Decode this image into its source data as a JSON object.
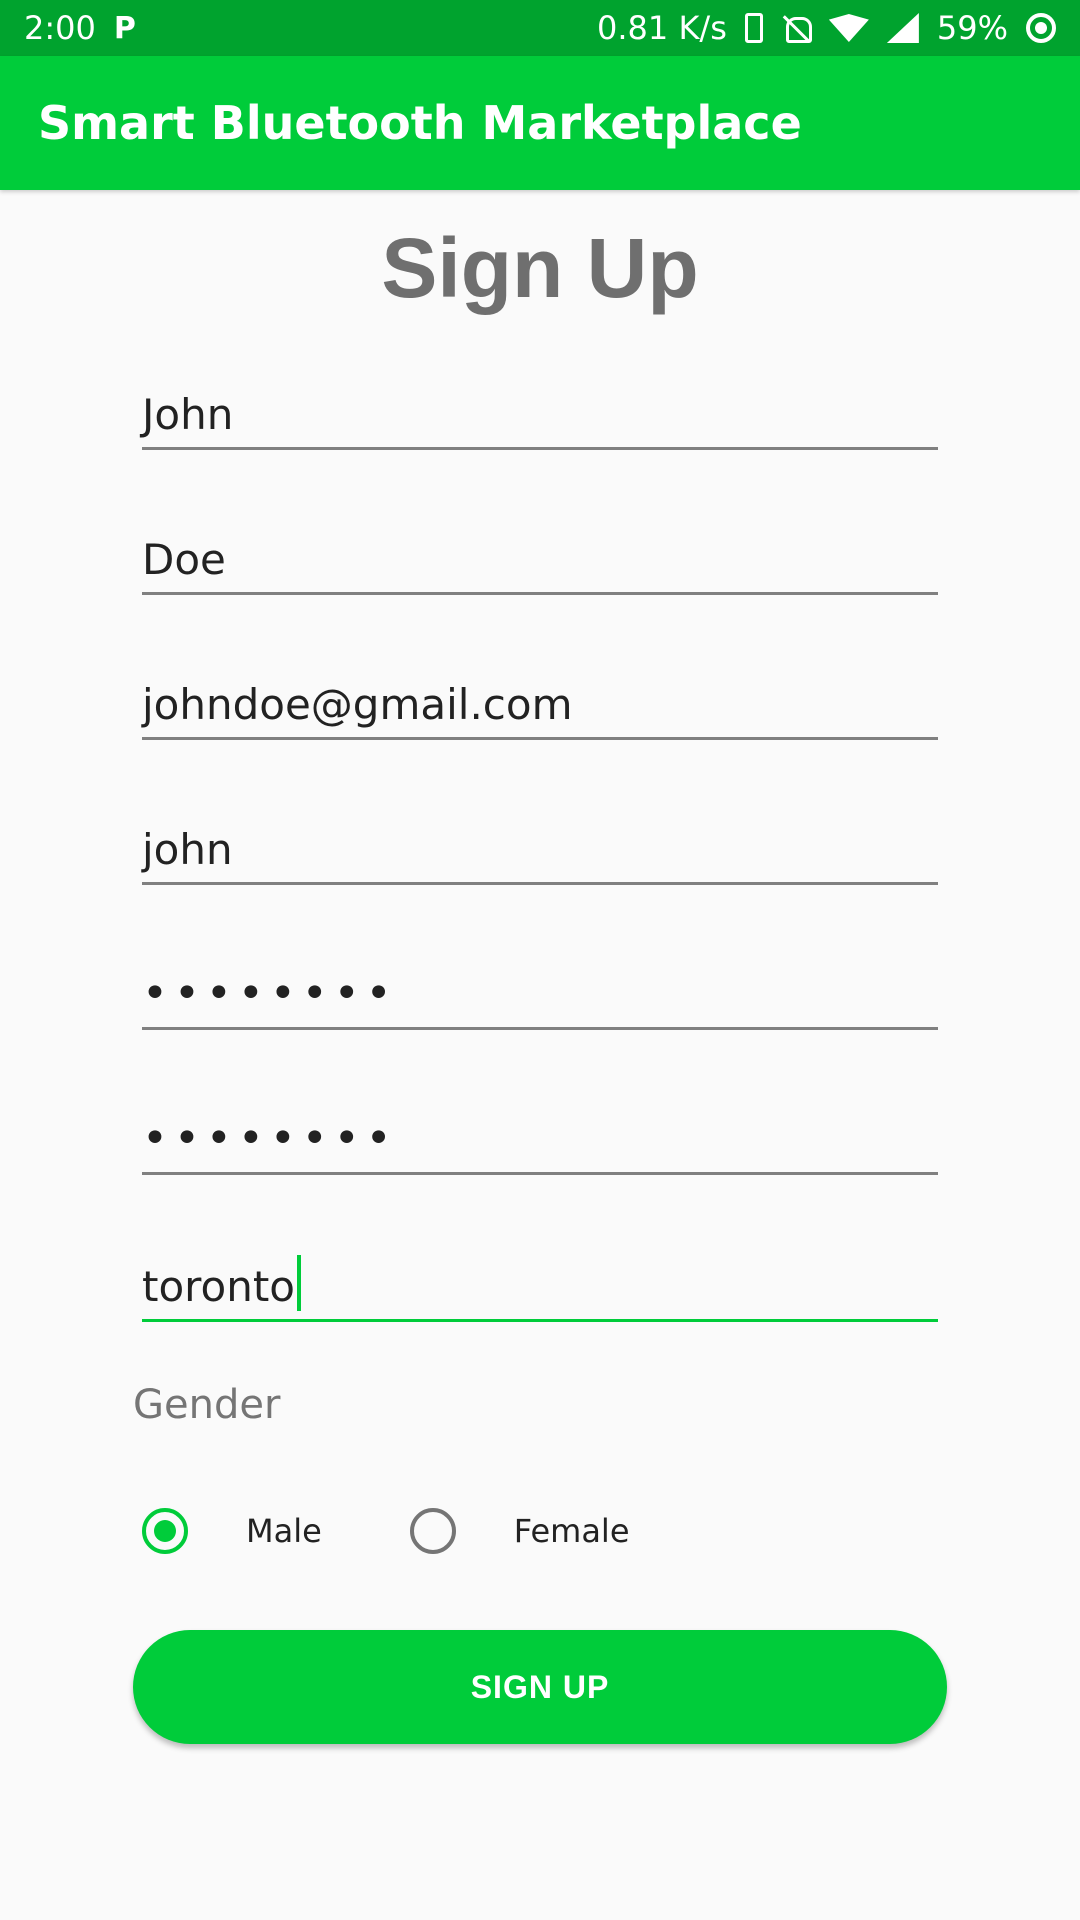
{
  "status_bar": {
    "time": "2:00",
    "p_icon": "P",
    "net_speed": "0.81 K/s",
    "battery": "59%",
    "icons": [
      "parking-app-icon",
      "phone-icon",
      "bell-off-icon",
      "wifi-icon",
      "signal-icon",
      "battery-ring-icon"
    ]
  },
  "app_bar": {
    "title": "Smart Bluetooth Marketplace"
  },
  "page": {
    "title": "Sign Up"
  },
  "form": {
    "first_name": "John",
    "last_name": "Doe",
    "email": "johndoe@gmail.com",
    "username": "john",
    "password": "••••••••",
    "confirm_password": "••••••••",
    "city": "toronto"
  },
  "gender": {
    "label": "Gender",
    "options": [
      "Male",
      "Female"
    ],
    "selected": "Male"
  },
  "button": {
    "label": "SIGN UP"
  },
  "colors": {
    "accent": "#00cc3a",
    "status_bar": "#00a32e",
    "title_gray": "#6f6f6f"
  }
}
